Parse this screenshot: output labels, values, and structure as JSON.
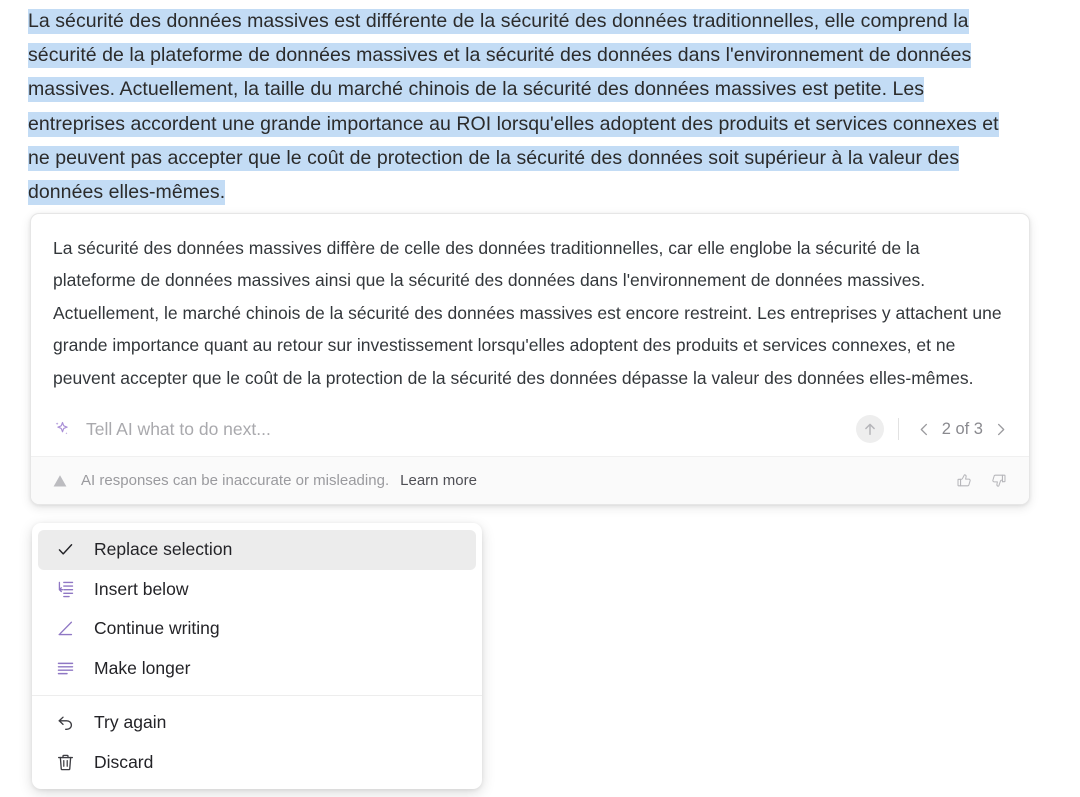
{
  "source": {
    "highlighted_text": "La sécurité des données massives est différente de la sécurité des données traditionnelles, elle comprend la sécurité de la plateforme de données massives et la sécurité des données dans l'environnement de données massives. Actuellement, la taille du marché chinois de la sécurité des données massives est petite. Les entreprises accordent une grande importance au ROI lorsqu'elles adoptent des produits et services connexes et ne peuvent pas accepter que le coût de protection de la sécurité des données soit supérieur à la valeur des données elles-mêmes.",
    "highlight_color": "#c3dcf5"
  },
  "ai_card": {
    "result_text": "La sécurité des données massives diffère de celle des données traditionnelles, car elle englobe la sécurité de la plateforme de données massives ainsi que la sécurité des données dans l'environnement de données massives. Actuellement, le marché chinois de la sécurité des données massives est encore restreint. Les entreprises y attachent une grande importance quant au retour sur investissement lorsqu'elles adoptent des produits et services connexes, et ne peuvent accepter que le coût de la protection de la sécurité des données dépasse la valeur des données elles-mêmes.",
    "prompt": {
      "icon": "sparkle-icon",
      "icon_color": "#a98fd6",
      "placeholder": "Tell AI what to do next...",
      "value": ""
    },
    "submit": {
      "icon": "arrow-up-circle-icon",
      "label": ""
    },
    "pager": {
      "prev_icon": "chevron-left-icon",
      "next_icon": "chevron-right-icon",
      "label": "2 of 3",
      "current": 2,
      "total": 3
    },
    "footer": {
      "warning_icon": "warning-triangle-icon",
      "disclaimer": "AI responses can be inaccurate or misleading.",
      "learn_more": "Learn more",
      "thumbs_up_icon": "thumbs-up-icon",
      "thumbs_down_icon": "thumbs-down-icon"
    }
  },
  "menu": {
    "groups": [
      {
        "items": [
          {
            "label": "Replace selection",
            "icon": "check-icon",
            "icon_color": "#232327",
            "selected": true
          },
          {
            "label": "Insert below",
            "icon": "insert-below-icon",
            "icon_color": "#8f77c4",
            "selected": false
          },
          {
            "label": "Continue writing",
            "icon": "pencil-line-icon",
            "icon_color": "#8f77c4",
            "selected": false
          },
          {
            "label": "Make longer",
            "icon": "text-lines-icon",
            "icon_color": "#8f77c4",
            "selected": false
          }
        ]
      },
      {
        "items": [
          {
            "label": "Try again",
            "icon": "undo-arrow-icon",
            "icon_color": "#3d3d42",
            "selected": false
          },
          {
            "label": "Discard",
            "icon": "trash-icon",
            "icon_color": "#3d3d42",
            "selected": false
          }
        ]
      }
    ]
  }
}
